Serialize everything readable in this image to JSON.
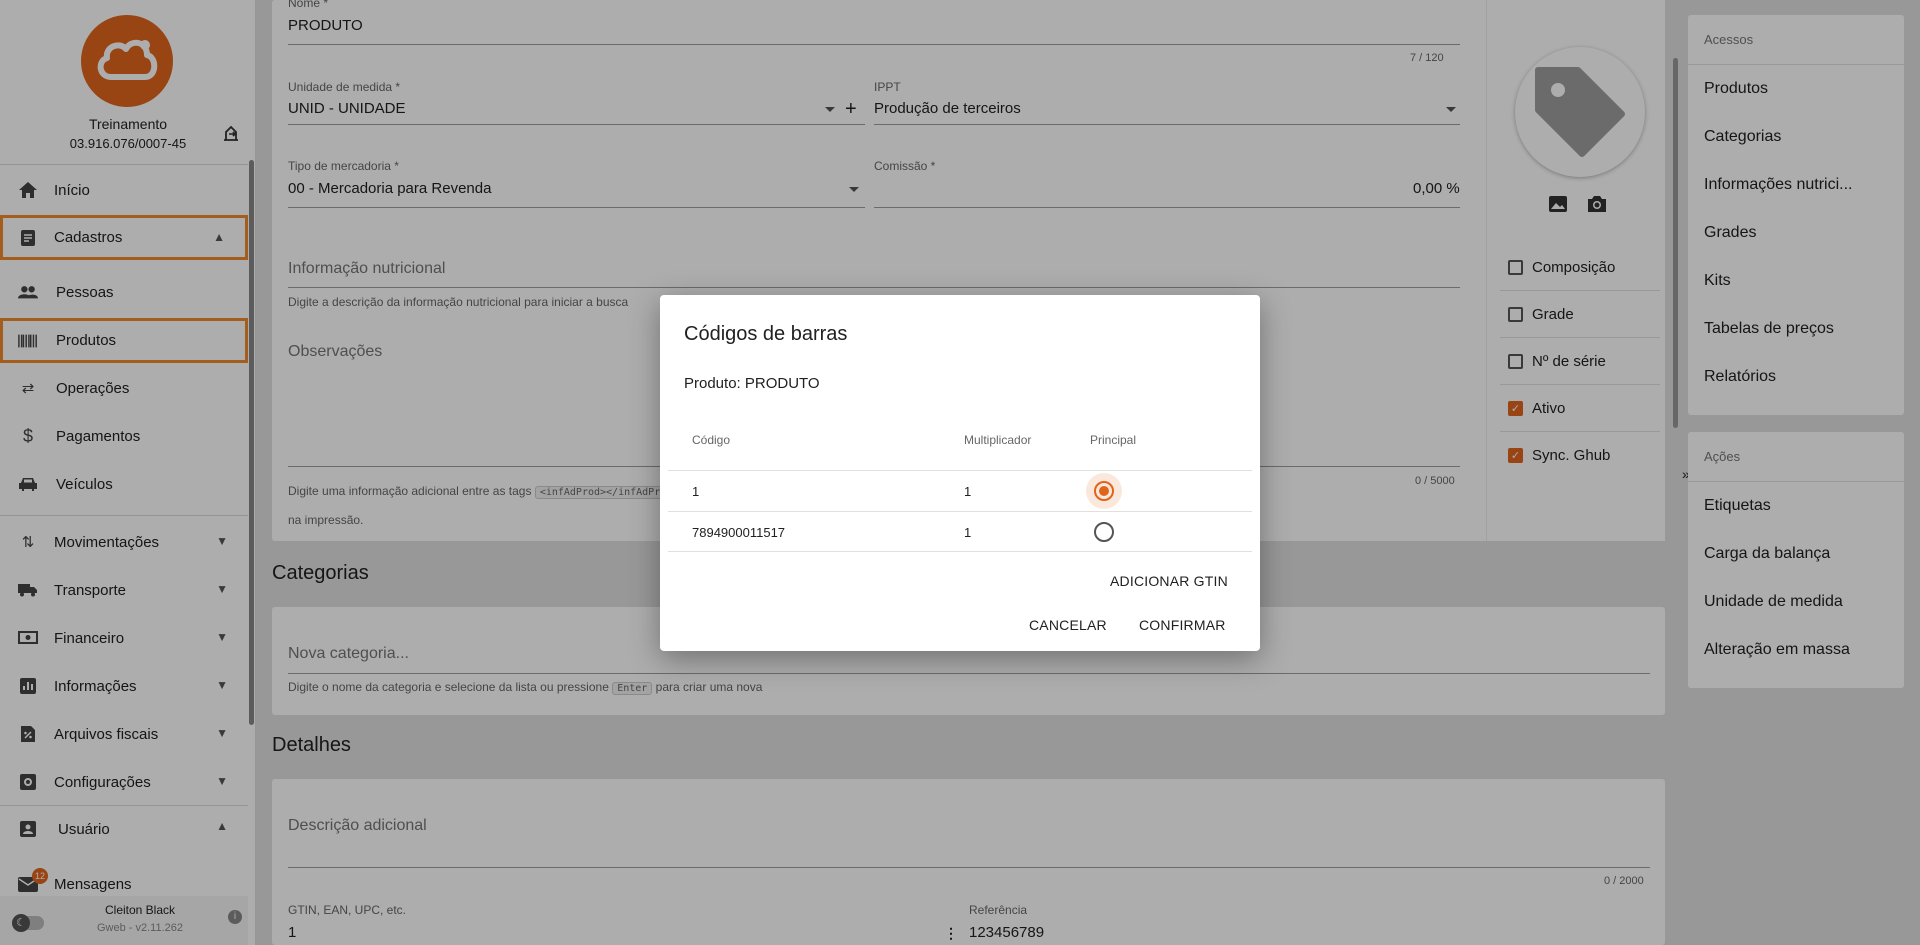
{
  "sidebar": {
    "company_name": "Treinamento",
    "company_cnpj": "03.916.076/0007-45",
    "items": [
      {
        "label": "Início"
      },
      {
        "label": "Cadastros"
      },
      {
        "label": "Pessoas"
      },
      {
        "label": "Produtos"
      },
      {
        "label": "Operações"
      },
      {
        "label": "Pagamentos"
      },
      {
        "label": "Veículos"
      },
      {
        "label": "Movimentações"
      },
      {
        "label": "Transporte"
      },
      {
        "label": "Financeiro"
      },
      {
        "label": "Informações"
      },
      {
        "label": "Arquivos fiscais"
      },
      {
        "label": "Configurações"
      },
      {
        "label": "Usuário"
      },
      {
        "label": "Mensagens"
      }
    ],
    "messages_badge": "12",
    "user_name": "Cleiton Black",
    "version": "Gweb - v2.11.262"
  },
  "form": {
    "nome_label": "Nome *",
    "nome_value": "PRODUTO",
    "nome_counter": "7 / 120",
    "unidade_label": "Unidade de medida *",
    "unidade_value": "UNID - UNIDADE",
    "ippt_label": "IPPT",
    "ippt_value": "Produção de terceiros",
    "tipo_label": "Tipo de mercadoria *",
    "tipo_value": "00 - Mercadoria para Revenda",
    "comissao_label": "Comissão *",
    "comissao_value": "0,00 %",
    "info_nutri_placeholder": "Informação nutricional",
    "info_nutri_hint": "Digite a descrição da informação nutricional para iniciar a busca",
    "obs_placeholder": "Observações",
    "obs_counter": "0 / 5000",
    "obs_hint_pre": "Digite uma informação adicional entre as tags",
    "obs_hint_tag": "<infAdProd></infAdProd>",
    "obs_hint_post": "na impressão."
  },
  "checkboxes": [
    {
      "label": "Composição",
      "checked": false
    },
    {
      "label": "Grade",
      "checked": false
    },
    {
      "label": "Nº de série",
      "checked": false
    },
    {
      "label": "Ativo",
      "checked": true
    },
    {
      "label": "Sync. Ghub",
      "checked": true
    }
  ],
  "categorias": {
    "title": "Categorias",
    "placeholder": "Nova categoria...",
    "hint_pre": "Digite o nome da categoria e selecione da lista ou pressione",
    "hint_key": "Enter",
    "hint_post": "para criar uma nova"
  },
  "detalhes": {
    "title": "Detalhes",
    "desc_placeholder": "Descrição adicional",
    "desc_counter": "0 / 2000",
    "gtin_label": "GTIN, EAN, UPC, etc.",
    "gtin_value": "1",
    "ref_label": "Referência",
    "ref_value": "123456789"
  },
  "acessos": {
    "title": "Acessos",
    "links": [
      "Produtos",
      "Categorias",
      "Informações nutrici...",
      "Grades",
      "Kits",
      "Tabelas de preços",
      "Relatórios"
    ]
  },
  "acoes": {
    "title": "Ações",
    "links": [
      "Etiquetas",
      "Carga da balança",
      "Unidade de medida",
      "Alteração em massa"
    ]
  },
  "dialog": {
    "title": "Códigos de barras",
    "product_line": "Produto: PRODUTO",
    "col_codigo": "Código",
    "col_multiplicador": "Multiplicador",
    "col_principal": "Principal",
    "rows": [
      {
        "codigo": "1",
        "multiplicador": "1",
        "principal": true
      },
      {
        "codigo": "7894900011517",
        "multiplicador": "1",
        "principal": false
      }
    ],
    "add_label": "ADICIONAR GTIN",
    "cancel_label": "CANCELAR",
    "confirm_label": "CONFIRMAR"
  },
  "colors": {
    "accent": "#e0651c",
    "highlight_border": "#f08a2c"
  }
}
